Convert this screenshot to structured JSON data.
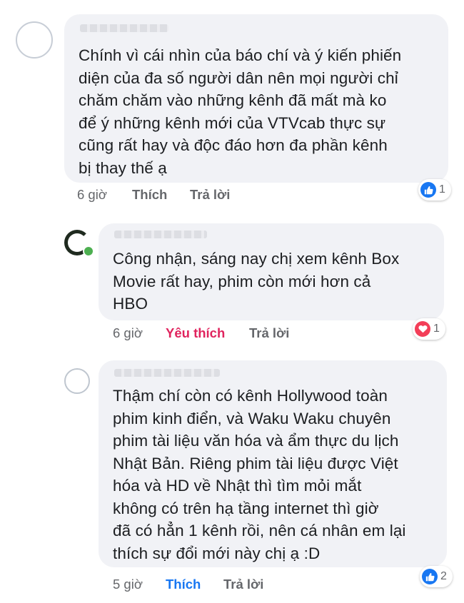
{
  "comments": [
    {
      "text": "Chính vì cái nhìn của báo chí và ý kiến phiến\ndiện của đa số người dân nên mọi người chỉ\nchăm chăm vào những kênh đã mất mà ko\nđể ý những kênh mới của VTVcab thực sự\ncũng rất hay và độc đáo hơn đa phần kênh\nbị thay thế ạ",
      "time": "6 giờ",
      "action_label": "Thích",
      "reply_label": "Trả lời",
      "reaction": {
        "icon": "like-icon",
        "count": "1",
        "color": "#1877f2"
      }
    },
    {
      "text": "Công nhận, sáng nay chị xem kênh Box\nMovie rất hay, phim còn mới hơn cả\nHBO",
      "time": "6 giờ",
      "action_label": "Yêu thích",
      "reply_label": "Trả lời",
      "reaction": {
        "icon": "heart-icon",
        "count": "1",
        "color": "#f33e58"
      }
    },
    {
      "text": "Thậm chí còn có kênh Hollywood toàn\nphim kinh điển, và Waku Waku chuyên\nphim tài liệu văn hóa và ẩm thực du lịch\nNhật Bản. Riêng phim tài liệu được Việt\nhóa và HD về Nhật thì tìm mỏi mắt\nkhông có trên hạ tầng internet thì giờ\nđã có hẳn 1 kênh rồi, nên cá nhân em lại\nthích sự đổi mới này chị ạ :D",
      "time": "5 giờ",
      "action_label": "Thích",
      "reply_label": "Trả lời",
      "reaction": {
        "icon": "like-icon",
        "count": "2",
        "color": "#1877f2"
      }
    }
  ],
  "colors": {
    "bubble_bg": "#f1f2f6",
    "text": "#1c1e21",
    "meta": "#65676b",
    "love_action": "#e0245e",
    "like_action": "#1877f2"
  }
}
